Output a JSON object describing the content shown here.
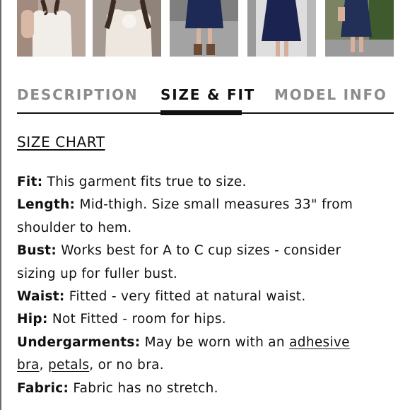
{
  "thumbnails": [
    {
      "name": "thumbnail-white-dress-1",
      "bg": "#b9a79c",
      "dress": "#f1ede8"
    },
    {
      "name": "thumbnail-white-dress-2",
      "bg": "#a59a92",
      "dress": "#ede7df"
    },
    {
      "name": "thumbnail-navy-dress-boots",
      "bg": "#8f8f8f",
      "dress": "#1c2a55"
    },
    {
      "name": "thumbnail-navy-dress-mirror",
      "bg": "#cfcfcf",
      "dress": "#1b2450"
    },
    {
      "name": "thumbnail-navy-dress-outdoor",
      "bg": "#5f6a4b",
      "dress": "#223058"
    }
  ],
  "tabs": {
    "description": "DESCRIPTION",
    "size_fit": "SIZE & FIT",
    "model_info": "MODEL INFO",
    "active": "size_fit"
  },
  "size_chart_link": "SIZE CHART",
  "details": {
    "fit": {
      "label": "Fit:",
      "text": " This garment fits true to size."
    },
    "length": {
      "label": "Length:",
      "text": " Mid-thigh. Size small measures 33\" from"
    },
    "length_cont": "shoulder to hem.",
    "bust": {
      "label": "Bust:",
      "text": " Works best for A to C cup sizes - consider"
    },
    "bust_cont": "sizing up for fuller bust.",
    "waist": {
      "label": "Waist:",
      "text": " Fitted - very fitted at natural waist."
    },
    "hip": {
      "label": "Hip:",
      "text": " Not Fitted - room for hips."
    },
    "undergarments": {
      "label": "Undergarments:",
      "text": " May be worn with an ",
      "link_adhesive": "adhesive",
      "link_bra": "bra",
      "sep": ", ",
      "link_petals": "petals",
      "tail": ", or no bra."
    },
    "fabric": {
      "label": "Fabric:",
      "text": " Fabric has no stretch."
    }
  }
}
